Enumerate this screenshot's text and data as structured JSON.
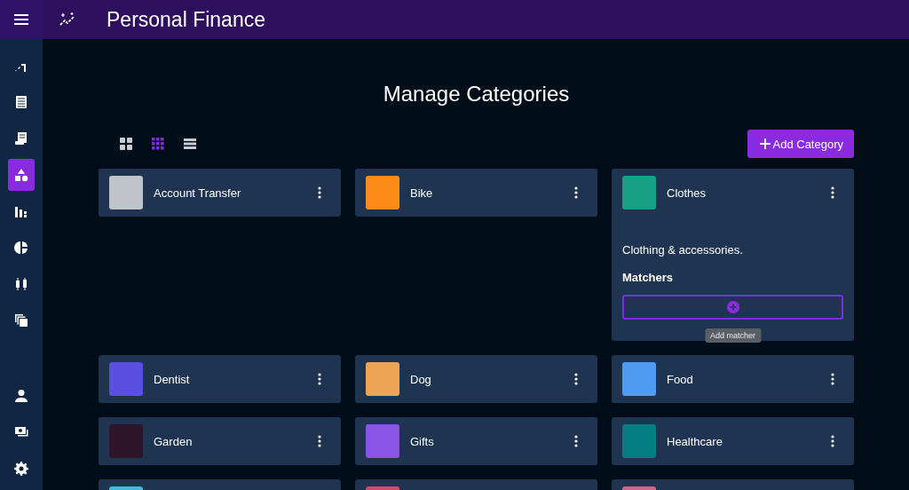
{
  "app_bar": {
    "title": "Personal Finance"
  },
  "sidebar": {
    "items": [
      {
        "kind": "trend",
        "selected": false
      },
      {
        "kind": "ledger",
        "selected": false
      },
      {
        "kind": "receipt",
        "selected": false
      },
      {
        "kind": "shapes",
        "selected": true
      },
      {
        "kind": "bars",
        "selected": false
      },
      {
        "kind": "pie",
        "selected": false
      },
      {
        "kind": "candles",
        "selected": false
      },
      {
        "kind": "copies",
        "selected": false
      }
    ],
    "bottom_items": [
      {
        "kind": "person",
        "selected": false
      },
      {
        "kind": "money",
        "selected": false
      },
      {
        "kind": "gear",
        "selected": false
      }
    ]
  },
  "page": {
    "title": "Manage Categories",
    "view_modes": [
      {
        "kind": "large",
        "selected": false
      },
      {
        "kind": "small",
        "selected": true
      },
      {
        "kind": "list",
        "selected": false
      }
    ],
    "add_button": "Add Category",
    "categories": [
      {
        "name": "Account Transfer",
        "color": "#c0c4c8"
      },
      {
        "name": "Bike",
        "color": "#fb8c1a"
      },
      {
        "name": "Clothes",
        "color": "#17a086",
        "expanded": true,
        "description": "Clothing & accessories.",
        "matchers_title": "Matchers",
        "tooltip": "Add matcher"
      },
      {
        "name": "Dentist",
        "color": "#5a4fe0"
      },
      {
        "name": "Dog",
        "color": "#eda455"
      },
      {
        "name": "Food",
        "color": "#4f9bf2"
      },
      {
        "name": "Garden",
        "color": "#2e1628"
      },
      {
        "name": "Gifts",
        "color": "#8a55e6"
      },
      {
        "name": "Healthcare",
        "color": "#047e80"
      },
      {
        "color": "#3bbdd4"
      },
      {
        "color": "#d24a6d"
      },
      {
        "color": "#d0648a"
      }
    ]
  }
}
